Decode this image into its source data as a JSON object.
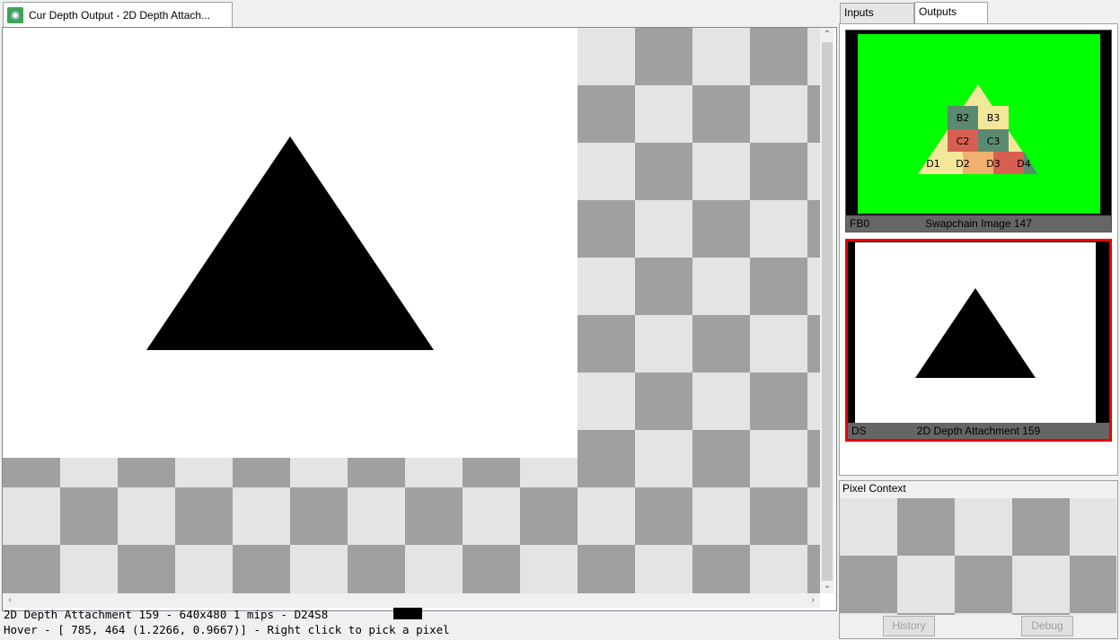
{
  "doc_tab": {
    "title": "Cur Depth Output - 2D Depth Attach..."
  },
  "status": {
    "texture_info": "2D Depth Attachment 159 - 640x480 1 mips - D24S8",
    "hover": "Hover - [ 785,  464 (1.2266, 0.9667)] - Right click to pick a pixel"
  },
  "right_tabs": [
    {
      "label": "Inputs",
      "active": false
    },
    {
      "label": "Outputs",
      "active": true
    }
  ],
  "outputs": {
    "fb0": {
      "slot": "FB0",
      "name": "Swapchain Image 147",
      "cells": [
        "B2",
        "B3",
        "C2",
        "C3",
        "D1",
        "D2",
        "D3",
        "D4"
      ],
      "background": "#00ff00"
    },
    "ds": {
      "slot": "DS",
      "name": "2D Depth Attachment 159",
      "selected": true
    }
  },
  "pixel_context": {
    "title": "Pixel Context",
    "history_label": "History",
    "debug_label": "Debug"
  },
  "colors": {
    "checker_dark": "#a0a0a0",
    "checker_light": "#e4e4e4",
    "selection_border": "#e80000",
    "tab_icon": "#3da35d"
  }
}
